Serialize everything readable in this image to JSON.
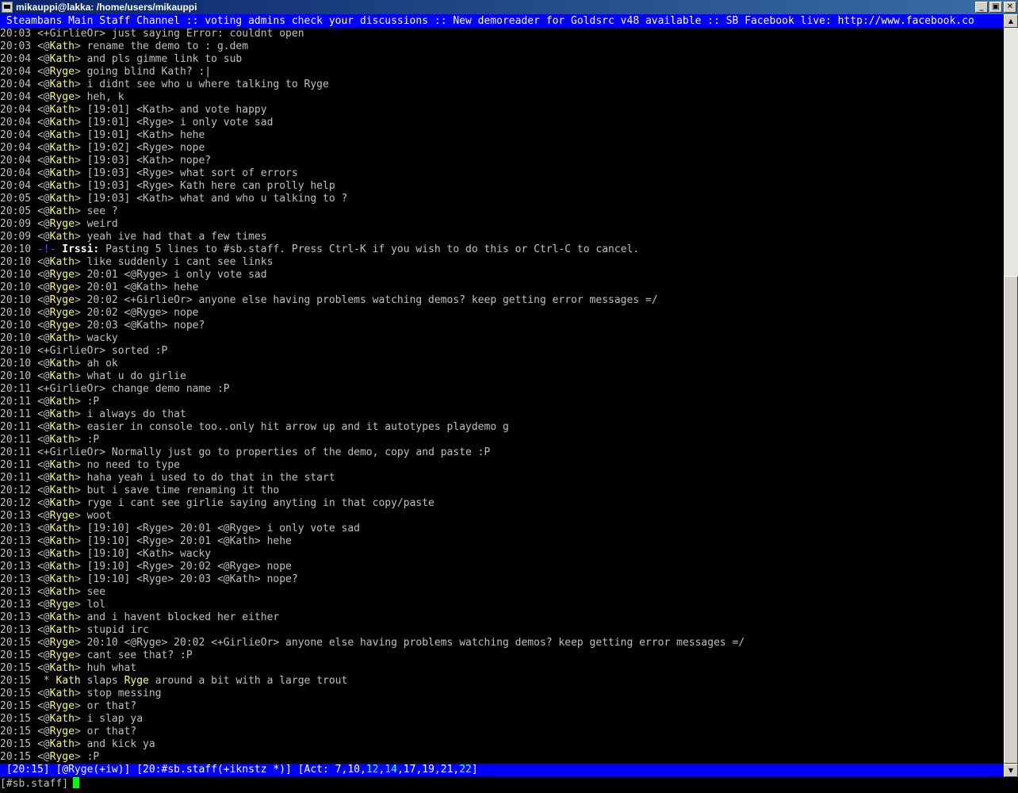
{
  "window": {
    "title": "mikauppi@lakka: /home/users/mikauppi"
  },
  "topic": " Steambans Main Staff Channel :: voting admins check your discussions :: New demoreader for Goldsrc v48 available :: SB Facebook live: http://www.facebook.co",
  "messages": [
    {
      "ts": "20:03",
      "pre": "<",
      "nick": "+GirlieOr",
      "post": "> ",
      "text": "just saying Error: couldnt open"
    },
    {
      "ts": "20:03",
      "pre": "<@",
      "nick": "Kath",
      "post": "> ",
      "text": "rename the demo to : g.dem"
    },
    {
      "ts": "20:04",
      "pre": "<@",
      "nick": "Kath",
      "post": "> ",
      "text": "and pls gimme link to sub"
    },
    {
      "ts": "20:04",
      "pre": "<@",
      "nick": "Ryge",
      "post": "> ",
      "text": "going blind Kath? :|"
    },
    {
      "ts": "20:04",
      "pre": "<@",
      "nick": "Kath",
      "post": "> ",
      "text": "i didnt see who u where talking to Ryge"
    },
    {
      "ts": "20:04",
      "pre": "<@",
      "nick": "Ryge",
      "post": "> ",
      "text": "heh, k"
    },
    {
      "ts": "20:04",
      "pre": "<@",
      "nick": "Kath",
      "post": "> ",
      "text": "[19:01] <Kath> and vote happy"
    },
    {
      "ts": "20:04",
      "pre": "<@",
      "nick": "Kath",
      "post": "> ",
      "text": "[19:01] <Ryge> i only vote sad"
    },
    {
      "ts": "20:04",
      "pre": "<@",
      "nick": "Kath",
      "post": "> ",
      "text": "[19:01] <Kath> hehe"
    },
    {
      "ts": "20:04",
      "pre": "<@",
      "nick": "Kath",
      "post": "> ",
      "text": "[19:02] <Ryge> nope"
    },
    {
      "ts": "20:04",
      "pre": "<@",
      "nick": "Kath",
      "post": "> ",
      "text": "[19:03] <Kath> nope?"
    },
    {
      "ts": "20:04",
      "pre": "<@",
      "nick": "Kath",
      "post": "> ",
      "text": "[19:03] <Ryge> what sort of errors"
    },
    {
      "ts": "20:04",
      "pre": "<@",
      "nick": "Kath",
      "post": "> ",
      "text": "[19:03] <Ryge> Kath here can prolly help"
    },
    {
      "ts": "20:05",
      "pre": "<@",
      "nick": "Kath",
      "post": "> ",
      "text": "[19:03] <Kath> what and who u talking to ?"
    },
    {
      "ts": "20:05",
      "pre": "<@",
      "nick": "Kath",
      "post": "> ",
      "text": "see ?"
    },
    {
      "ts": "20:09",
      "pre": "<@",
      "nick": "Ryge",
      "post": "> ",
      "text": "weird"
    },
    {
      "ts": "20:09",
      "pre": "<@",
      "nick": "Kath",
      "post": "> ",
      "text": "yeah ive had that a few times"
    },
    {
      "ts": "20:10",
      "pre": "",
      "nick": "",
      "post": "",
      "text": "Pasting 5 lines to #sb.staff. Press Ctrl-K if you wish to do this or Ctrl-C to cancel.",
      "irssi": "Irssi:",
      "dash": "-!-"
    },
    {
      "ts": "20:10",
      "pre": "<@",
      "nick": "Kath",
      "post": "> ",
      "text": "like suddenly i cant see links"
    },
    {
      "ts": "20:10",
      "pre": "<@",
      "nick": "Ryge",
      "post": "> ",
      "text": "20:01 <@Ryge> i only vote sad"
    },
    {
      "ts": "20:10",
      "pre": "<@",
      "nick": "Ryge",
      "post": "> ",
      "text": "20:01 <@Kath> hehe"
    },
    {
      "ts": "20:10",
      "pre": "<@",
      "nick": "Ryge",
      "post": "> ",
      "text": "20:02 <+GirlieOr> anyone else having problems watching demos? keep getting error messages =/"
    },
    {
      "ts": "20:10",
      "pre": "<@",
      "nick": "Ryge",
      "post": "> ",
      "text": "20:02 <@Ryge> nope"
    },
    {
      "ts": "20:10",
      "pre": "<@",
      "nick": "Ryge",
      "post": "> ",
      "text": "20:03 <@Kath> nope?"
    },
    {
      "ts": "20:10",
      "pre": "<@",
      "nick": "Kath",
      "post": "> ",
      "text": "wacky"
    },
    {
      "ts": "20:10",
      "pre": "<",
      "nick": "+GirlieOr",
      "post": "> ",
      "text": "sorted :P"
    },
    {
      "ts": "20:10",
      "pre": "<@",
      "nick": "Kath",
      "post": "> ",
      "text": "ah ok"
    },
    {
      "ts": "20:10",
      "pre": "<@",
      "nick": "Kath",
      "post": "> ",
      "text": "what u do girlie"
    },
    {
      "ts": "20:11",
      "pre": "<",
      "nick": "+GirlieOr",
      "post": "> ",
      "text": "change demo name :P"
    },
    {
      "ts": "20:11",
      "pre": "<@",
      "nick": "Kath",
      "post": "> ",
      "text": ":P"
    },
    {
      "ts": "20:11",
      "pre": "<@",
      "nick": "Kath",
      "post": "> ",
      "text": "i always do that"
    },
    {
      "ts": "20:11",
      "pre": "<@",
      "nick": "Kath",
      "post": "> ",
      "text": "easier in console too..only hit arrow up and it autotypes playdemo g"
    },
    {
      "ts": "20:11",
      "pre": "<@",
      "nick": "Kath",
      "post": "> ",
      "text": ":P"
    },
    {
      "ts": "20:11",
      "pre": "<",
      "nick": "+GirlieOr",
      "post": "> ",
      "text": "Normally just go to properties of the demo, copy and paste :P"
    },
    {
      "ts": "20:11",
      "pre": "<@",
      "nick": "Kath",
      "post": "> ",
      "text": "no need to type"
    },
    {
      "ts": "20:11",
      "pre": "<@",
      "nick": "Kath",
      "post": "> ",
      "text": "haha yeah i used to do that in the start"
    },
    {
      "ts": "20:12",
      "pre": "<@",
      "nick": "Kath",
      "post": "> ",
      "text": "but i save time renaming it tho"
    },
    {
      "ts": "20:12",
      "pre": "<@",
      "nick": "Kath",
      "post": "> ",
      "text": "ryge i cant see girlie saying anyting in that copy/paste"
    },
    {
      "ts": "20:13",
      "pre": "<@",
      "nick": "Ryge",
      "post": "> ",
      "text": "woot"
    },
    {
      "ts": "20:13",
      "pre": "<@",
      "nick": "Kath",
      "post": "> ",
      "text": "[19:10] <Ryge> 20:01 <@Ryge> i only vote sad"
    },
    {
      "ts": "20:13",
      "pre": "<@",
      "nick": "Kath",
      "post": "> ",
      "text": "[19:10] <Ryge> 20:01 <@Kath> hehe"
    },
    {
      "ts": "20:13",
      "pre": "<@",
      "nick": "Kath",
      "post": "> ",
      "text": "[19:10] <Kath> wacky"
    },
    {
      "ts": "20:13",
      "pre": "<@",
      "nick": "Kath",
      "post": "> ",
      "text": "[19:10] <Ryge> 20:02 <@Ryge> nope"
    },
    {
      "ts": "20:13",
      "pre": "<@",
      "nick": "Kath",
      "post": "> ",
      "text": "[19:10] <Ryge> 20:03 <@Kath> nope?"
    },
    {
      "ts": "20:13",
      "pre": "<@",
      "nick": "Kath",
      "post": "> ",
      "text": "see"
    },
    {
      "ts": "20:13",
      "pre": "<@",
      "nick": "Ryge",
      "post": "> ",
      "text": "lol"
    },
    {
      "ts": "20:13",
      "pre": "<@",
      "nick": "Kath",
      "post": "> ",
      "text": "and i havent blocked her either"
    },
    {
      "ts": "20:13",
      "pre": "<@",
      "nick": "Kath",
      "post": "> ",
      "text": "stupid irc"
    },
    {
      "ts": "20:15",
      "pre": "<@",
      "nick": "Ryge",
      "post": "> ",
      "text": "20:10 <@Ryge> 20:02 <+GirlieOr> anyone else having problems watching demos? keep getting error messages =/"
    },
    {
      "ts": "20:15",
      "pre": "<@",
      "nick": "Ryge",
      "post": "> ",
      "text": "cant see that? :P"
    },
    {
      "ts": "20:15",
      "pre": "<@",
      "nick": "Kath",
      "post": "> ",
      "text": "huh what"
    },
    {
      "ts": "20:15",
      "pre": " * ",
      "nick": "Kath",
      "post": " ",
      "text": "slaps Ryge around a bit with a large trout",
      "action": true
    },
    {
      "ts": "20:15",
      "pre": "<@",
      "nick": "Kath",
      "post": "> ",
      "text": "stop messing"
    },
    {
      "ts": "20:15",
      "pre": "<@",
      "nick": "Ryge",
      "post": "> ",
      "text": "or that?"
    },
    {
      "ts": "20:15",
      "pre": "<@",
      "nick": "Kath",
      "post": "> ",
      "text": "i slap ya"
    },
    {
      "ts": "20:15",
      "pre": "<@",
      "nick": "Ryge",
      "post": "> ",
      "text": "or that?"
    },
    {
      "ts": "20:15",
      "pre": "<@",
      "nick": "Kath",
      "post": "> ",
      "text": "and kick ya"
    },
    {
      "ts": "20:15",
      "pre": "<@",
      "nick": "Ryge",
      "post": "> ",
      "text": ":P"
    }
  ],
  "statusbar": {
    "time": "[20:15]",
    "nick": "[@Ryge(+iw)]",
    "channel": "[20:#sb.staff(+iknstz *)]",
    "act_label": "[Act: ",
    "act": [
      {
        "n": "7",
        "sep": ","
      },
      {
        "n": "10",
        "sep": ","
      },
      {
        "n": "12",
        "sep": ",",
        "hl": true
      },
      {
        "n": "14",
        "sep": ",",
        "hl": true
      },
      {
        "n": "17",
        "sep": ","
      },
      {
        "n": "19",
        "sep": ","
      },
      {
        "n": "21",
        "sep": ","
      },
      {
        "n": "22",
        "sep": "",
        "hl": true
      }
    ],
    "act_close": "]"
  },
  "input": {
    "prompt": "[#sb.staff]",
    "value": ""
  },
  "colors": {
    "topic_bg": "#0000ff",
    "nick_highlight": "#ffff55",
    "cursor": "#00ff00"
  }
}
